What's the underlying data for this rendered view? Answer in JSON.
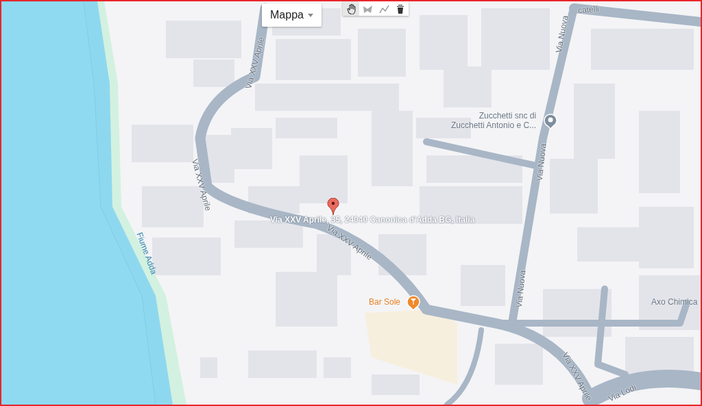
{
  "map_type_control": {
    "label": "Mappa"
  },
  "drawing_tools": [
    {
      "kind": "hand",
      "selected": true
    },
    {
      "kind": "marker",
      "selected": false
    },
    {
      "kind": "line",
      "selected": false
    },
    {
      "kind": "delete",
      "selected": false
    }
  ],
  "marker": {
    "address": "Via XXV Aprile, 35, 24040 Canonica d'Adda BG, Italia"
  },
  "street_labels": [
    {
      "text": "Via XXV Aprile",
      "kind": "street"
    },
    {
      "text": "Via XXV Aprile",
      "kind": "street"
    },
    {
      "text": "Via XXV Aprile",
      "kind": "street"
    },
    {
      "text": "Via XXV Aprile",
      "kind": "street"
    },
    {
      "text": "Via Nuova",
      "kind": "street"
    },
    {
      "text": "Via Nuova",
      "kind": "street"
    },
    {
      "text": "Via Nuova",
      "kind": "street"
    },
    {
      "text": "Via Lodi",
      "kind": "street"
    },
    {
      "text": "catelli",
      "kind": "street"
    },
    {
      "text": "Fiume Adda",
      "kind": "water"
    }
  ],
  "places": [
    {
      "lines": [
        "Zucchetti snc di",
        "Zucchetti Antonio e C..."
      ],
      "kind": "business"
    },
    {
      "lines": [
        "Bar Sole"
      ],
      "kind": "bar"
    },
    {
      "lines": [
        "Axo Chimica"
      ],
      "kind": "label"
    }
  ]
}
